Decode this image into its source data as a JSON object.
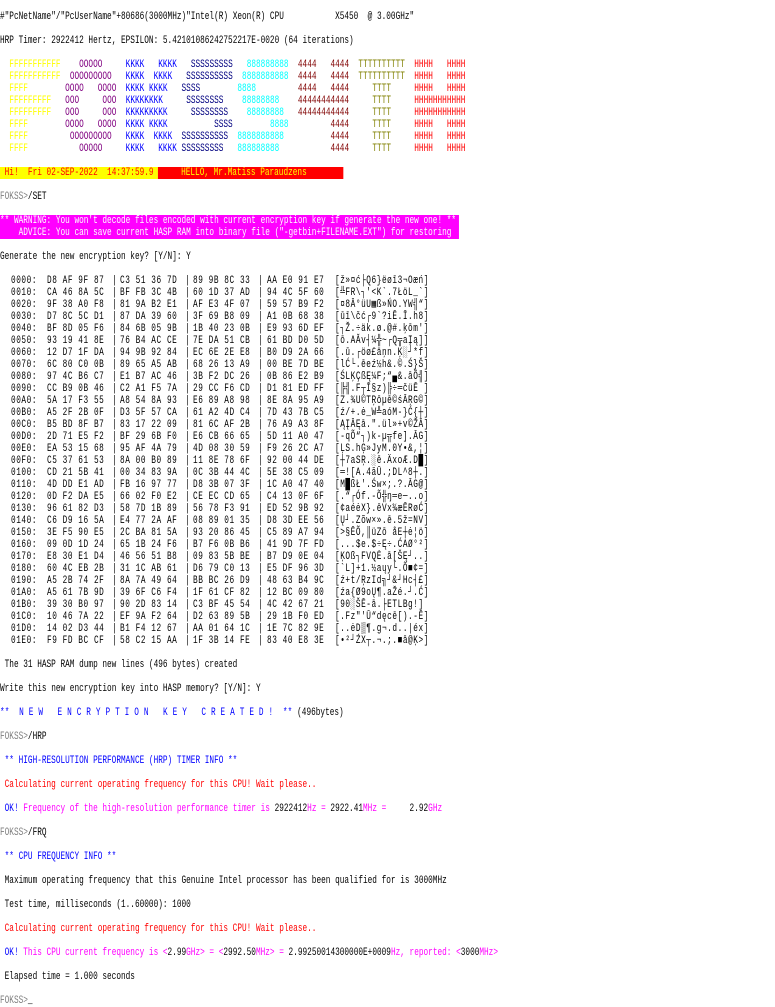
{
  "header": {
    "system_line": "#\"PcNetName\"/\"PcUserName\"+80686(3000MHz)\"Intel(R) Xeon(R) CPU           X5450  @ 3.00GHz\"",
    "hrp_line": "HRP Timer: 2922412 Hertz, EPSILON: 5.42101086242752217E-0020 (64 iterations)"
  },
  "banner": {
    "rows": [
      "  FFFFFFFFFFF    OOOOO     KKKK   KKKK   SSSSSSSSS   888888888  4444   4444  TTTTTTTTTT  HHHH   HHHH",
      "  FFFFFFFFFFF  OOOOOOOOO   KKKK  KKKK   SSSSSSSSSS  8888888888  4444   4444  TTTTTTTTTT  HHHH   HHHH",
      "  FFFF        OOOO   OOOO  KKKK KKKK   SSSS        8888         4444   4444     TTTT     HHHH   HHHH",
      "  FFFFFFFFF   OOO     OOO  KKKKKKKK     SSSSSSSS    88888888    44444444444     TTTT     HHHHHHHHHHH",
      "  FFFFFFFFF   OOO     OOO  KKKKKKKKK     SSSSSSSS    88888888   44444444444     TTTT     HHHHHHHHHHH",
      "  FFFF        OOOO   OOOO  KKKK KKKK          SSSS        8888         4444     TTTT     HHHH   HHHH",
      "  FFFF         OOOOOOOOO   KKKK  KKKK  SSSSSSSSSS  8888888888          4444     TTTT     HHHH   HHHH",
      "  FFFF           OOOOO     KKKK   KKKK SSSSSSSSS   888888888           4444     TTTT     HHHH   HHHH"
    ],
    "colors": {
      "F": "#ffff00",
      "O": "#800080",
      "K": "#0000ff",
      "S": "#000080",
      "8": "#00ffff",
      "4": "#800000",
      "T": "#808000",
      "H": "#ff0000"
    }
  },
  "greeting": {
    "date_text": " Hi!  Fri 02-SEP-2022  14:37:59.9",
    "hello_text": "HELLO, Mr.Matiss Paraudzens"
  },
  "prompt": "FOKSS>",
  "set_session": {
    "command": "/SET",
    "warning_line1": "** WARNING: You won't decode files encoded with current encryption key if generate the new one! **",
    "warning_line2": "    ADVICE: You can save current HASP RAM into binary file (\"-getbin+FILENAME.EXT\") for restoring",
    "generate_question": "Generate the new encryption key? [Y/N]: Y",
    "dump": [
      {
        "offset": "0000:",
        "hex": [
          "D8 AF 9F 87",
          "C3 51 36 7D",
          "89 9B 8C 33",
          "AA E0 91 E7"
        ],
        "ascii": "[ž»¤ć├Q6}ëøī3¬Oæń]"
      },
      {
        "offset": "0010:",
        "hex": [
          "CA 46 8A 5C",
          "BF FB 3C 4B",
          "60 1D 37 AD",
          "94 4C 5F 60"
        ],
        "ascii": "[╩FR\\┐'<K`.7ŁöL_`]"
      },
      {
        "offset": "0020:",
        "hex": [
          "9F 38 A0 F8",
          "81 9A B2 E1",
          "AF E3 4F 07",
          "59 57 B9 F2"
        ],
        "ascii": "[¤8Ā°üU▦ß»ŃO.YW╣“]"
      },
      {
        "offset": "0030:",
        "hex": [
          "D7 8C 5C D1",
          "87 DA 39 60",
          "3F 69 B8 09",
          "A1 0B 68 38"
        ],
        "ascii": "[ūī\\čć┌9`?iĒ.Ī.h8]"
      },
      {
        "offset": "0040:",
        "hex": [
          "BF 8D 05 F6",
          "84 6B 05 9B",
          "1B 40 23 0B",
          "E9 93 6D EF"
        ],
        "ascii": "[┐Ž.÷äk.ø.@#.ķōm']"
      },
      {
        "offset": "0050:",
        "hex": [
          "93 19 41 8E",
          "76 B4 AC CE",
          "7E DA 51 CB",
          "61 BD D0 5D"
        ],
        "ascii": "[ō.AĂv┤¼╬~┌Q╦aĮą]]"
      },
      {
        "offset": "0060:",
        "hex": [
          "12 D7 1F DA",
          "94 9B 92 84",
          "EC 6E 2E E8",
          "B0 D9 2A 66"
        ],
        "ascii": "[.ū.┌öø£äņn.Ķ░┘*f]"
      },
      {
        "offset": "0070:",
        "hex": [
          "6C 80 C0 0B",
          "89 65 A5 AB",
          "68 26 13 A9",
          "00 BE 7D BE"
        ],
        "ascii": "[lĆ└.ēeź½h&.©.Ś}Š]"
      },
      {
        "offset": "0080:",
        "hex": [
          "97 4C B6 C7",
          "E1 B7 AC 46",
          "3B F2 DC 26",
          "0B 86 E2 B9"
        ],
        "ascii": "[ŚLĶÇßĘ¼F;“▄&.āÕ╣]"
      },
      {
        "offset": "0090:",
        "hex": [
          "CC B9 0B 46",
          "C2 A1 F5 7A",
          "29 CC F6 CD",
          "D1 81 ED FF"
        ],
        "ascii": "[╠╣.F┬Ī§z)╠÷═čüĒ ]"
      },
      {
        "offset": "00A0:",
        "hex": [
          "5A 17 F3 55",
          "A8 54 8A 93",
          "E6 89 A8 98",
          "8E 8A 95 A9"
        ],
        "ascii": "[Z.¾U©TŖōµē©śĀŖG©]"
      },
      {
        "offset": "00B0:",
        "hex": [
          "A5 2F 2B 0F",
          "D3 5F 57 CA",
          "61 A2 4D C4",
          "7D 43 7B C5"
        ],
        "ascii": "[ź/+.ė_W╩aóM-}Ć{┼]"
      },
      {
        "offset": "00C0:",
        "hex": [
          "B5 BD 8F B7",
          "83 17 22 09",
          "81 6C AF 2B",
          "76 A9 A3 8F"
        ],
        "ascii": "[ĄĮĀĘā.\".ül»+v©ŽĀ]"
      },
      {
        "offset": "00D0:",
        "hex": [
          "2D 71 E5 F2",
          "BF 29 6B F0",
          "E6 CB 66 65",
          "5D 11 A0 47"
        ],
        "ascii": "[-qÕ“┐)k-µ╦fe].ĀG]"
      },
      {
        "offset": "00E0:",
        "hex": [
          "EA 53 15 68",
          "95 AF 4A 79",
          "4D 08 30 59",
          "F9 26 2C A7"
        ],
        "ascii": "[ĻS.hĢ»JyM.0Y•&,¦]"
      },
      {
        "offset": "00F0:",
        "hex": [
          "C5 37 61 53",
          "8A 00 B0 89",
          "11 8E 78 6F",
          "92 00 44 DE"
        ],
        "ascii": "[┼7aSŖ.░ē.ÄxoÆ.D█]"
      },
      {
        "offset": "0100:",
        "hex": [
          "CD 21 5B 41",
          "00 34 83 9A",
          "0C 3B 44 4C",
          "5E 38 C5 09"
        ],
        "ascii": "[═![A.4ăŪ.;DL^8┼.]"
      },
      {
        "offset": "0110:",
        "hex": [
          "4D DD E1 AD",
          "FB 16 97 77",
          "D8 3B 07 3F",
          "1C A0 47 40"
        ],
        "ascii": "[M█ßŁ'.Św×;.?.ĀG@]"
      },
      {
        "offset": "0120:",
        "hex": [
          "0D F2 DA E5",
          "66 02 F0 E2",
          "CE EC CD 65",
          "C4 13 0F 6F"
        ],
        "ascii": "[.“┌Óf.-Õ╬ŋ═e─..o]"
      },
      {
        "offset": "0130:",
        "hex": [
          "96 61 82 D3",
          "58 7D 1B 89",
          "56 78 F3 91",
          "ED 52 9B 92"
        ],
        "ascii": "[¢aéėX}.ēVx¾æĒRøĆ]"
      },
      {
        "offset": "0140:",
        "hex": [
          "C6 D9 16 5A",
          "E4 77 2A AF",
          "08 89 01 35",
          "D8 3D EE 56"
        ],
        "ascii": "[Ų┘.Zõw×».ē.5ž=NV]"
      },
      {
        "offset": "0150:",
        "hex": [
          "3E F5 90 E5",
          "2C BA 81 5A",
          "93 20 86 45",
          "C5 89 A7 94"
        ],
        "ascii": "[>§ĒÕ,║üZō åE┼ė¦ö]"
      },
      {
        "offset": "0160:",
        "hex": [
          "09 0D 1D 24",
          "65 1B 24 F6",
          "B7 F6 0B B6",
          "41 9D 7F FD"
        ],
        "ascii": "[...$e.$÷Ę÷.ĆAØ°²]"
      },
      {
        "offset": "0170:",
        "hex": [
          "E8 30 E1 D4",
          "46 56 51 B8",
          "09 83 5B BE",
          "B7 D9 0E 04"
        ],
        "ascii": "[ĶOß┐FVQĖ.ā[ŠĘ┘..]"
      },
      {
        "offset": "0180:",
        "hex": [
          "60 4C EB 2B",
          "31 1C AB 61",
          "D6 79 C0 13",
          "E5 DF 96 3D"
        ],
        "ascii": "[`L]+1.½aųy└.Õ■¢=]"
      },
      {
        "offset": "0190:",
        "hex": [
          "A5 2B 74 2F",
          "8A 7A 49 64",
          "BB BC 26 D9",
          "48 63 B4 9C"
        ],
        "ascii": "[ź+t/ŖzId╗┘&┘Hc┤£]"
      },
      {
        "offset": "01A0:",
        "hex": [
          "A5 61 7B 9D",
          "39 6F C6 F4",
          "1F 61 CF 82",
          "12 BC 09 80"
        ],
        "ascii": "[źa{Ø9oŲ¶.aŽé.┘.Ć]"
      },
      {
        "offset": "01B0:",
        "hex": [
          "39 30 B0 97",
          "90 2D 83 14",
          "C3 BF 45 54",
          "4C 42 67 21"
        ],
        "ascii": "[90░ŠĒ-ā.├ETLBg!]"
      },
      {
        "offset": "01C0:",
        "hex": [
          "10 46 7A 22",
          "EF 9A F2 64",
          "D2 63 89 5B",
          "29 1B F0 ED"
        ],
        "ascii": "[.Fz\"'Ū“dęcē[).-Ē]"
      },
      {
        "offset": "01D0:",
        "hex": [
          "14 02 D3 44",
          "B1 F4 12 67",
          "AA 01 64 1C",
          "1E 7C 82 9E"
        ],
        "ascii": "[..ėD▒¶.g¬.d..|éx]"
      },
      {
        "offset": "01E0:",
        "hex": [
          "F9 FD BC CF",
          "58 C2 15 AA",
          "1F 3B 14 FE",
          "83 40 E8 3E"
        ],
        "ascii": "[•²┘ŹX┬.¬.;.■ā@Ķ>]"
      }
    ],
    "dump_summary": "The 31 HASP RAM dump new lines (496 bytes) created",
    "write_question": "Write this new encryption key into HASP memory? [Y/N]: Y",
    "created_banner": "**  N E W   E N C R Y P T I O N   K E Y   C R E A T E D !  **",
    "created_bytes": " (496bytes)"
  },
  "hrp_session": {
    "command": "/HRP",
    "title": "** HIGH-RESOLUTION PERFORMANCE (HRP) TIMER INFO **",
    "calculating": "Calculating current operating frequency for this CPU! Wait please..",
    "ok": "OK!",
    "result_label": " Frequency of the high-resolution performance timer is ",
    "hz_value": "2922412",
    "hz_unit": "Hz = ",
    "mhz_value": "2922.41",
    "mhz_unit": "MHz = ",
    "ghz_value": "    2.92",
    "ghz_unit": "GHz"
  },
  "frq_session": {
    "command": "/FRQ",
    "title": "** CPU FREQUENCY INFO **",
    "max_freq": "Maximum operating frequency that this Genuine Intel processor has been qualified for is 3000MHz",
    "test_time": "Test time, milliseconds (1..60000): 1000",
    "calculating": "Calculating current operating frequency for this CPU! Wait please..",
    "ok": "OK!",
    "result_label": " This CPU current frequency is <",
    "ghz_value": "2.99",
    "ghz_unit": "GHz> = <",
    "mhz_value": "2992.50",
    "mhz_unit": "MHz> = ",
    "hz_value": "2.99250014300000E+0009",
    "reported_label": "Hz, reported: <",
    "reported_value": "3000",
    "reported_unit": "MHz>",
    "elapsed": "Elapsed time = 1.000 seconds"
  },
  "final_prompt": {
    "cursor": "_"
  }
}
